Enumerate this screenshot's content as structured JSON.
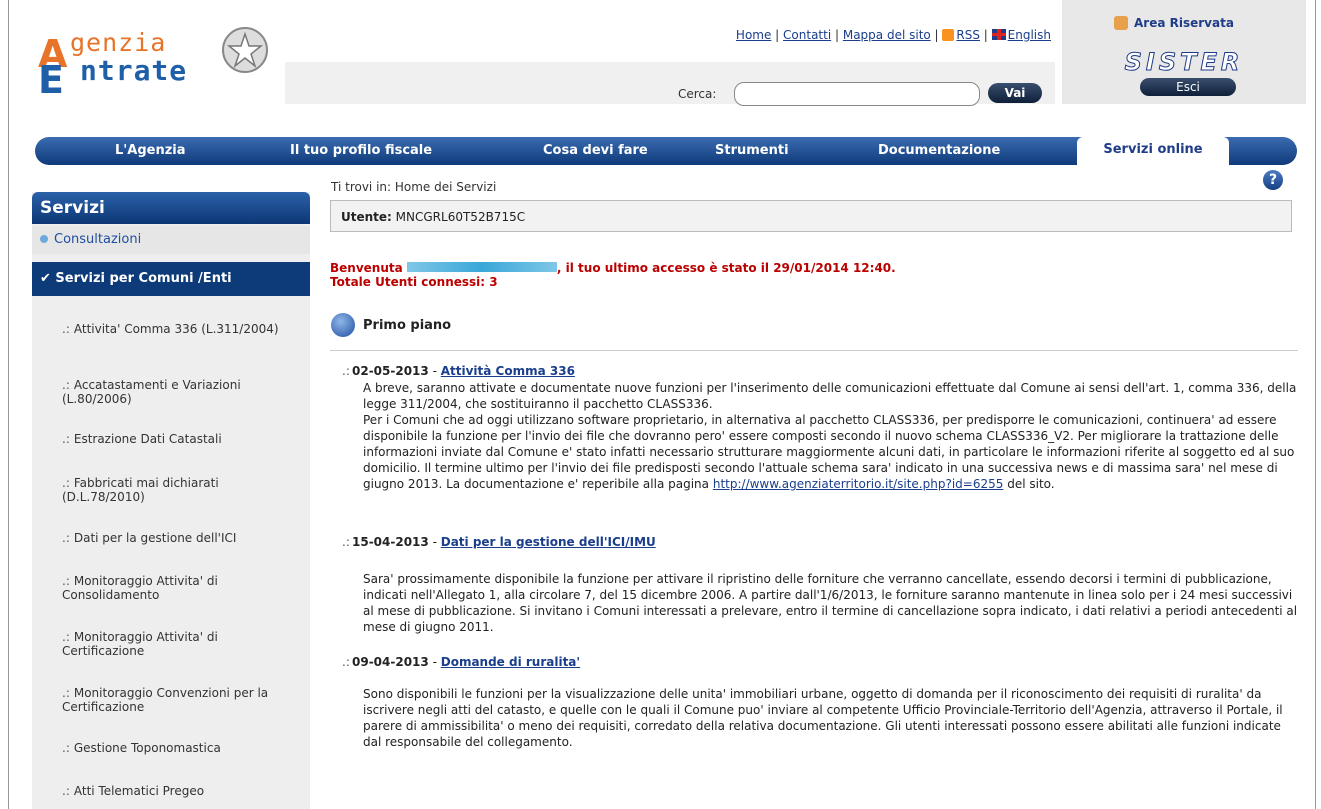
{
  "header": {
    "logo_line1": "genzia",
    "logo_line2": "ntrate",
    "logo_cap1": "A",
    "logo_cap2": "E",
    "links": [
      "Home",
      "Contatti",
      "Mappa del sito",
      "RSS",
      "English"
    ],
    "search_label": "Cerca:",
    "search_value": "",
    "search_button": "Vai",
    "area_title": "Area Riservata",
    "area_brand": "SISTER",
    "exit_button": "Esci"
  },
  "nav": {
    "items": [
      "L'Agenzia",
      "Il tuo profilo fiscale",
      "Cosa devi fare",
      "Strumenti",
      "Documentazione",
      "Servizi online"
    ],
    "active": "Servizi online"
  },
  "sidebar": {
    "title": "Servizi",
    "consultazioni": "Consultazioni",
    "selected": "Servizi per Comuni /Enti",
    "items": [
      "Attivita' Comma 336 (L.311/2004)",
      "Accatastamenti e Variazioni (L.80/2006)",
      "Estrazione Dati Catastali",
      "Fabbricati mai dichiarati (D.L.78/2010)",
      "Dati per la gestione dell'ICI",
      "Monitoraggio Attivita' di Consolidamento",
      "Monitoraggio Attivita' di Certificazione",
      "Monitoraggio Convenzioni per la Certificazione",
      "Gestione Toponomastica",
      "Atti Telematici Pregeo"
    ]
  },
  "main": {
    "breadcrumb": "Ti trovi in: Home dei Servizi",
    "user_label": "Utente:",
    "user_value": "MNCGRL60T52B715C",
    "welcome_pre": "Benvenuta",
    "welcome_post": ", il tuo ultimo accesso è stato il 29/01/2014 12:40.",
    "connected": "Totale Utenti connessi: 3",
    "section_title": "Primo piano",
    "news": [
      {
        "date": "02-05-2013",
        "title": "Attività Comma 336",
        "body": "A breve, saranno attivate e documentate nuove funzioni per l'inserimento delle comunicazioni effettuate dal Comune ai sensi dell'art. 1, comma 336, della legge 311/2004, che sostituiranno il pacchetto CLASS336.",
        "body2": "Per i Comuni che ad oggi utilizzano software proprietario, in alternativa al pacchetto CLASS336, per predisporre le comunicazioni, continuera' ad essere disponibile la funzione per l'invio dei file che dovranno pero' essere composti secondo il nuovo schema CLASS336_V2. Per migliorare la trattazione delle informazioni inviate dal Comune e' stato infatti necessario strutturare maggiormente alcuni dati, in particolare le informazioni riferite al soggetto ed al suo domicilio. Il termine ultimo per l'invio dei file predisposti secondo l'attuale schema sara' indicato in una successiva news e di massima sara' nel mese di giugno 2013. La documentazione e' reperibile alla pagina",
        "link": "http://www.agenziaterritorio.it/site.php?id=6255",
        "tail": "del sito."
      },
      {
        "date": "15-04-2013",
        "title": "Dati per la gestione dell'ICI/IMU",
        "body": "Sara' prossimamente disponibile la funzione per attivare il ripristino delle forniture che verranno cancellate, essendo decorsi i termini di pubblicazione, indicati nell'Allegato 1, alla circolare 7, del 15 dicembre 2006. A partire dall'1/6/2013, le forniture saranno mantenute in linea solo per i 24 mesi successivi al mese di pubblicazione. Si invitano i Comuni interessati a prelevare, entro il termine di cancellazione sopra indicato, i dati relativi a periodi antecedenti al mese di giugno 2011."
      },
      {
        "date": "09-04-2013",
        "title": "Domande di ruralita'",
        "body": "Sono disponibili le funzioni per la visualizzazione delle unita' immobiliari urbane, oggetto di domanda per il riconoscimento dei requisiti di ruralita' da iscrivere negli atti del catasto, e quelle con le quali il Comune puo' inviare al competente Ufficio Provinciale-Territorio dell'Agenzia, attraverso il Portale, il parere di ammissibilita' o meno dei requisiti, corredato della relativa documentazione. Gli utenti interessati possono essere abilitati alle funzioni indicate dal responsabile del collegamento."
      }
    ]
  }
}
